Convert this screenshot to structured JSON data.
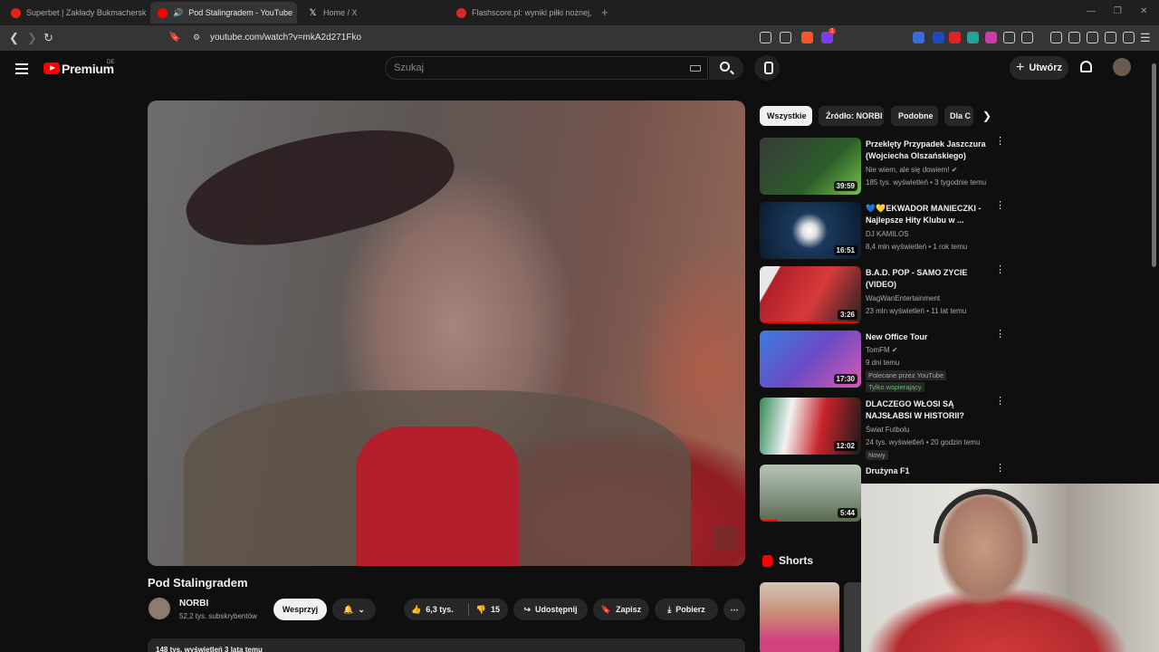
{
  "browser": {
    "tabs": [
      {
        "title": "Superbet | Zakłady Bukmacherskie Online",
        "favicon_color": "#e2231a",
        "active": false
      },
      {
        "title": "Pod Stalingradem - YouTube",
        "favicon_color": "#ff0000",
        "active": true,
        "audio_icon": "speaker-icon"
      },
      {
        "title": "Home / X",
        "favicon_color": "#ffffff",
        "active": false
      },
      {
        "title": "Flashscore.pl: wyniki piłki nożnej, wyniki",
        "favicon_color": "#d92a2a",
        "active": false
      }
    ],
    "close_glyph": "✕",
    "new_tab_glyph": "+",
    "url": "youtube.com/watch?v=mkA2d271Fko",
    "back_glyph": "❮",
    "forward_glyph": "❯",
    "reload_glyph": "↻",
    "brave_badge": "1"
  },
  "masthead": {
    "logo_text": "Premium",
    "logo_country": "DE",
    "search_placeholder": "Szukaj",
    "create_label": "Utwórz",
    "create_glyph": "+"
  },
  "video": {
    "title": "Pod Stalingradem",
    "channel": "NORBI",
    "subscribers": "52,2 tys. subskrybentów",
    "support_label": "Wesprzyj",
    "likes": "6,3 tys.",
    "dislikes": "15",
    "share_label": "Udostępnij",
    "save_label": "Zapisz",
    "download_label": "Pobierz",
    "views_line": "148 tys. wyświetleń  3 lata temu"
  },
  "chips": [
    "Wszystkie",
    "Źródło: NORBI",
    "Podobne",
    "Dla C"
  ],
  "recommendations": [
    {
      "title": "Przeklęty Przypadek Jaszczura (Wojciecha Olszańskiego)",
      "channel": "Nie wiem, ale się dowiem!",
      "verified": true,
      "meta": "185 tys. wyświetleń • 3 tygodnie temu",
      "duration": "39:59",
      "thumb_color": "#4b8a3b"
    },
    {
      "title": "💙💛EKWADOR MANIECZKI - Najlepsze Hity Klubu w ...",
      "channel": "DJ KAMILOS",
      "verified": false,
      "meta": "8,4 mln wyświetleń • 1 rok temu",
      "duration": "16:51",
      "thumb_color": "#1a3a5c"
    },
    {
      "title": "B.A.D. POP - SAMO ZYCIE (VIDEO)",
      "channel": "WagWanEntertainment",
      "verified": false,
      "meta": "23 mln wyświetleń • 11 lat temu",
      "duration": "3:26",
      "thumb_color": "#a8202a"
    },
    {
      "title": "New Office Tour",
      "channel": "TomFM",
      "verified": true,
      "meta": "9 dni temu",
      "badge1": "Polecane przez YouTube",
      "badge2": "Tylko wspierający",
      "duration": "17:30",
      "thumb_color": "#6a4bc4"
    },
    {
      "title": "DLACZEGO WŁOSI SĄ NAJSŁABSI W HISTORII?",
      "channel": "Świat Futbolu",
      "verified": false,
      "meta": "24 tys. wyświetleń • 20 godzin temu",
      "badge1": "Nowy",
      "duration": "12:02",
      "thumb_color": "#b7242b"
    },
    {
      "title": "Drużyna F1",
      "channel": "",
      "verified": false,
      "meta": "",
      "duration": "5:44",
      "thumb_color": "#8a9a8a"
    }
  ],
  "shorts_label": "Shorts"
}
